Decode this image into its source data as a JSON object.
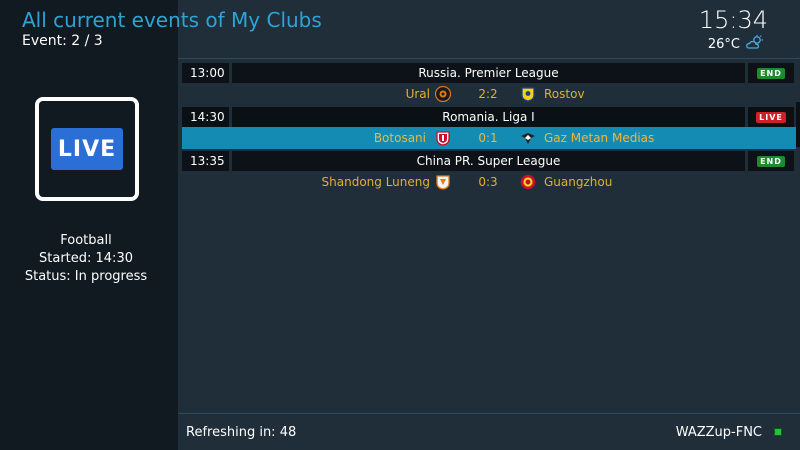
{
  "header": {
    "title": "All current events of My Clubs",
    "event_counter": "Event: 2 / 3",
    "clock": "15:34",
    "temperature": "26°C",
    "weather_icon": "partly-cloudy-icon"
  },
  "details": {
    "badge": "LIVE",
    "sport": "Football",
    "started": "Started: 14:30",
    "status": "Status: In progress"
  },
  "events": [
    {
      "time": "13:00",
      "league": "Russia. Premier League",
      "status": "END",
      "home": "Ural",
      "score": "2:2",
      "away": "Rostov"
    },
    {
      "time": "14:30",
      "league": "Romania. Liga I",
      "status": "LIVE",
      "home": "Botosani",
      "score": "0:1",
      "away": "Gaz Metan Medias"
    },
    {
      "time": "13:35",
      "league": "China PR. Super League",
      "status": "END",
      "home": "Shandong Luneng",
      "score": "0:3",
      "away": "Guangzhou"
    }
  ],
  "footer": {
    "refresh": "Refreshing in: 48",
    "brand": "WAZZup-FNC"
  },
  "colors": {
    "accent": "#2da3d6",
    "selected_row": "#148bb2",
    "team_text": "#e0b032",
    "end_badge": "#1d8a2e",
    "live_badge": "#d11f2a",
    "live_tile": "#2b6fd6",
    "indicator": "#24c23a"
  }
}
